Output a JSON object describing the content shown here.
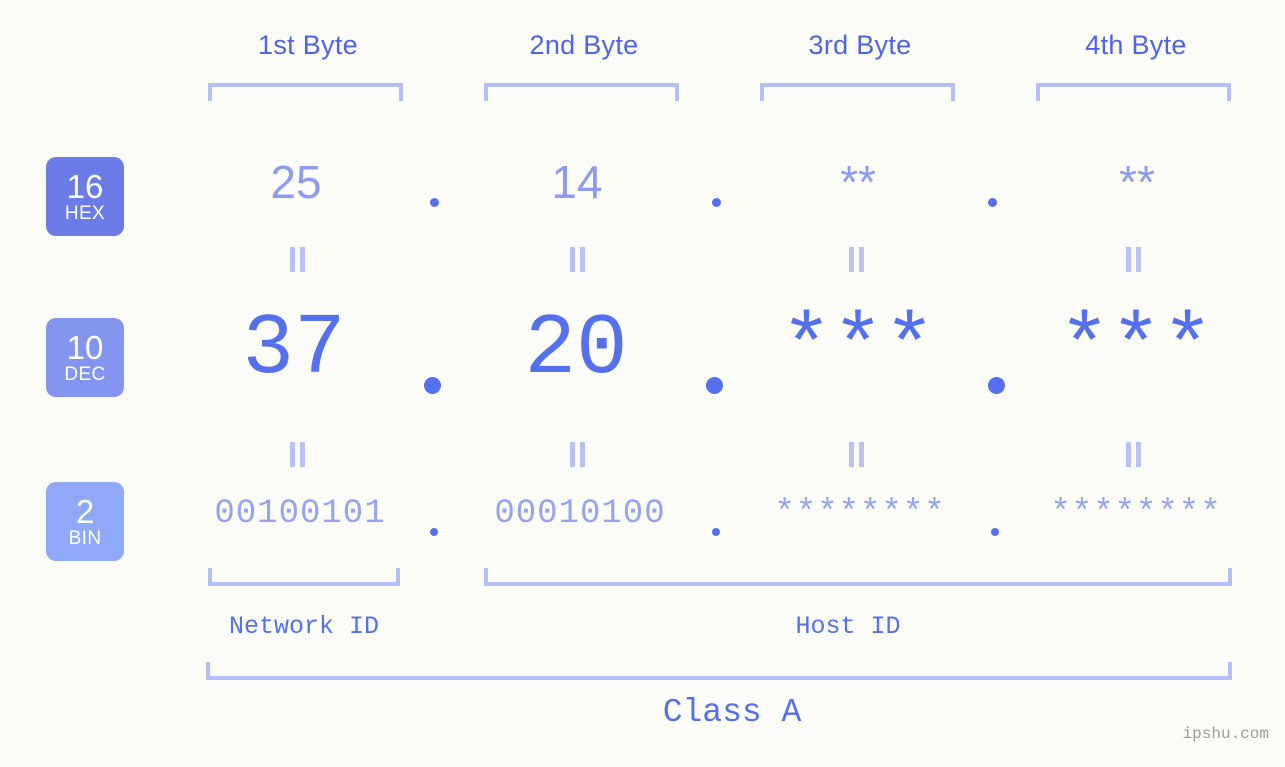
{
  "meta": {
    "watermark": "ipshu.com",
    "background_color": "#fcfdf8",
    "accent_color": "#5470ef",
    "light_accent_color": "#b4bef9"
  },
  "byte_headers": [
    {
      "label": "1st Byte"
    },
    {
      "label": "2nd Byte"
    },
    {
      "label": "3rd Byte"
    },
    {
      "label": "4th Byte"
    }
  ],
  "bases": [
    {
      "number": "16",
      "abbr": "HEX",
      "color": "#6b7ce8"
    },
    {
      "number": "10",
      "abbr": "DEC",
      "color": "#8495f0"
    },
    {
      "number": "2",
      "abbr": "BIN",
      "color": "#8fa8f7"
    }
  ],
  "rows": {
    "hex": {
      "values": [
        "25",
        "14",
        "**",
        "**"
      ]
    },
    "dec": {
      "values": [
        "37",
        "20",
        "***",
        "***"
      ]
    },
    "bin": {
      "values": [
        "00100101",
        "00010100",
        "********",
        "********"
      ]
    }
  },
  "separator": ".",
  "sections": [
    {
      "label": "Network ID"
    },
    {
      "label": "Host ID"
    }
  ],
  "class": {
    "label": "Class A"
  }
}
